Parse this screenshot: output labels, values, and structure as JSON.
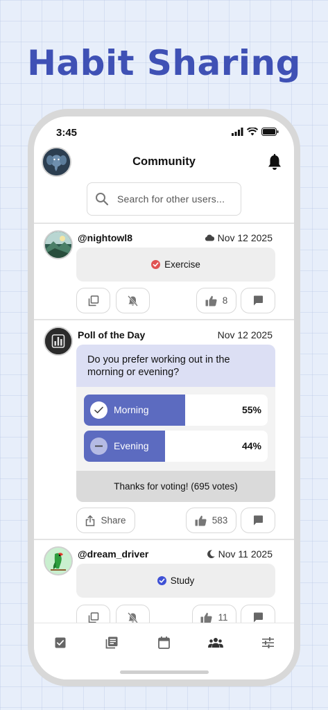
{
  "headline": "Habit Sharing",
  "status_bar": {
    "time": "3:45"
  },
  "header": {
    "title": "Community"
  },
  "search": {
    "placeholder": "Search for other users..."
  },
  "posts": [
    {
      "user": "@nightowl8",
      "date": "Nov 12 2025",
      "date_icon": "cloud-icon",
      "habit": "Exercise",
      "habit_color": "#e05252",
      "like_count": "8"
    },
    {
      "user": "Poll of the Day",
      "date": "Nov 12 2025",
      "poll": {
        "question": "Do you prefer working out in the morning or evening?",
        "options": [
          {
            "label": "Morning",
            "percent": "55%",
            "fill": 0.55,
            "selected": true
          },
          {
            "label": "Evening",
            "percent": "44%",
            "fill": 0.44,
            "selected": false
          }
        ],
        "footer": "Thanks for voting! (695 votes)"
      },
      "share_label": "Share",
      "like_count": "583"
    },
    {
      "user": "@dream_driver",
      "date": "Nov 11 2025",
      "date_icon": "moon-icon",
      "habit": "Study",
      "habit_color": "#3f51d5",
      "like_count": "11"
    }
  ],
  "nav": [
    "checkbox-icon",
    "journal-icon",
    "calendar-icon",
    "community-icon",
    "sliders-icon"
  ],
  "colors": {
    "accent": "#3f51b5",
    "poll_fill": "#5c6bc0",
    "poll_question_bg": "#dcdff4"
  }
}
